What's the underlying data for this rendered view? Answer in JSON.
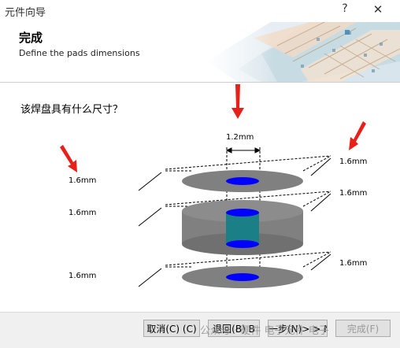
{
  "window": {
    "title": "元件向导",
    "help_glyph": "?",
    "close_glyph": "✕"
  },
  "header": {
    "title": "完成",
    "subtitle": "Define the pads dimensions"
  },
  "main": {
    "question": "该焊盘具有什么尺寸？",
    "dims": {
      "top_width": "1.2mm",
      "left_top": "1.6mm",
      "left_mid": "1.6mm",
      "left_bottom": "1.6mm",
      "right_1": "1.6mm",
      "right_2": "1.6mm",
      "right_3": "1.6mm"
    }
  },
  "footer": {
    "cancel": "取消(C) (C)",
    "back": "退回(B) B",
    "next": "一步(N)> > N",
    "finish": "完成(F)",
    "watermark": "公众号 · 硬件 电子元件 电子"
  },
  "colors": {
    "pad_gray": "#808080",
    "drill_blue": "#0000ff",
    "arrow_red": "#e8201a",
    "barrel_teal": "#1a7f86"
  },
  "icons": [
    "help-icon",
    "close-icon",
    "red-arrow-icon",
    "pcb-banner-image"
  ]
}
